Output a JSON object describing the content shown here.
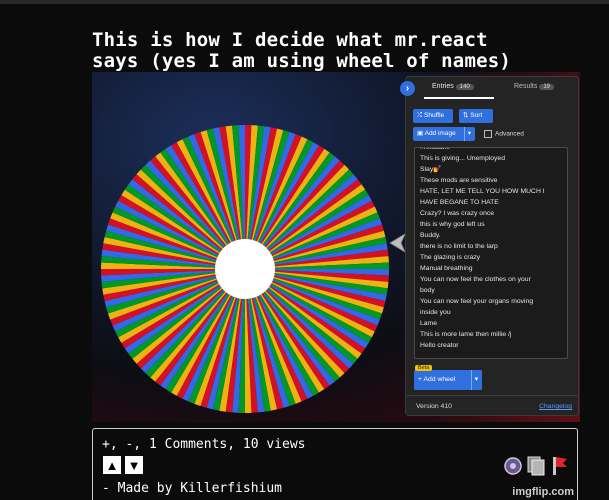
{
  "caption": "This is how I decide what mr.react\nsays (yes I am using wheel of names)",
  "wheel": {
    "colors": [
      "#3369e8",
      "#d50f25",
      "#eeb211",
      "#009925"
    ],
    "segments": 140
  },
  "panel": {
    "collapse_icon": "chevron-right-icon",
    "tabs": [
      {
        "label": "Entries",
        "count": "140"
      },
      {
        "label": "Results",
        "count": "19"
      }
    ],
    "shuffle_label": "Shuffle",
    "sort_label": "Sort",
    "add_image_label": "Add image",
    "advanced_label": "Advanced",
    "entries": [
      "#relatable",
      "This is giving... Unemployed",
      "Slay💅",
      "These mods are sensitive",
      "HATE, LET ME TELL YOU HOW MUCH I",
      "HAVE BEGANE TO HATE",
      "Crazy? I was crazy once",
      "this is why god left us",
      "Buddy.",
      "there is no limit to the larp",
      "The glazing is crazy",
      "Manual breathing",
      "You can now feel the clothes on your",
      "body",
      "You can now feel your organs moving",
      "inside you",
      "Lame",
      "This is more lame then millie /j",
      "Hello creator"
    ],
    "beta_label": "Beta",
    "add_wheel_label": "Add wheel",
    "version": "Version 410",
    "changelog": "Changelog"
  },
  "footer": {
    "stats": "+, -, 1 Comments, 10 views",
    "made_by": "- Made by Killerfishium"
  },
  "watermark": "imgflip.com"
}
